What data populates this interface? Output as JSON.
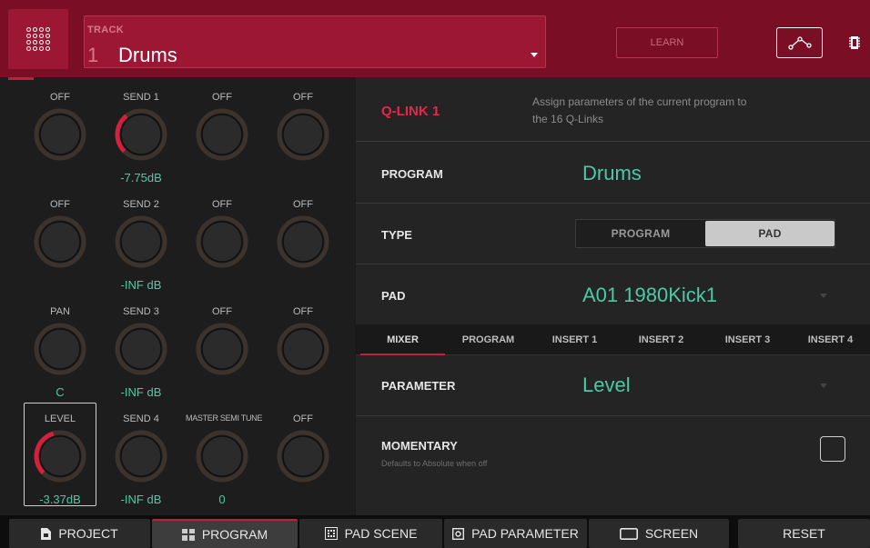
{
  "header": {
    "track_label": "TRACK",
    "track_number": "1",
    "track_name": "Drums",
    "learn_label": "LEARN",
    "grid_icon": "grid-dots-icon",
    "env_icon": "envelope-curve-icon",
    "chip_icon": "chip-icon"
  },
  "knobs": [
    {
      "label": "OFF",
      "value": "",
      "level": 0
    },
    {
      "label": "SEND 1",
      "value": "-7.75dB",
      "level": 0.36
    },
    {
      "label": "OFF",
      "value": "",
      "level": 0
    },
    {
      "label": "OFF",
      "value": "",
      "level": 0
    },
    {
      "label": "OFF",
      "value": "",
      "level": 0
    },
    {
      "label": "SEND 2",
      "value": "-INF dB",
      "level": 0
    },
    {
      "label": "OFF",
      "value": "",
      "level": 0
    },
    {
      "label": "OFF",
      "value": "",
      "level": 0
    },
    {
      "label": "PAN",
      "value": "C",
      "level": 0
    },
    {
      "label": "SEND 3",
      "value": "-INF dB",
      "level": 0
    },
    {
      "label": "OFF",
      "value": "",
      "level": 0
    },
    {
      "label": "OFF",
      "value": "",
      "level": 0
    },
    {
      "label": "LEVEL",
      "value": "-3.37dB",
      "level": 0.44,
      "selected": true
    },
    {
      "label": "SEND 4",
      "value": "-INF dB",
      "level": 0
    },
    {
      "label": "MASTER SEMI TUNE",
      "value": "0",
      "level": 0
    },
    {
      "label": "OFF",
      "value": "",
      "level": 0
    }
  ],
  "qlink": {
    "title": "Q-LINK 1",
    "description": "Assign parameters of the current program to the 16 Q-Links"
  },
  "program": {
    "label": "PROGRAM",
    "value": "Drums"
  },
  "type": {
    "label": "TYPE",
    "options": [
      "PROGRAM",
      "PAD"
    ],
    "selected": "PAD"
  },
  "pad": {
    "label": "PAD",
    "value": "A01 1980Kick1"
  },
  "tabs": [
    "MIXER",
    "PROGRAM",
    "INSERT 1",
    "INSERT 2",
    "INSERT 3",
    "INSERT 4"
  ],
  "active_tab": "MIXER",
  "parameter": {
    "label": "PARAMETER",
    "value": "Level"
  },
  "momentary": {
    "label": "MOMENTARY",
    "sub": "Defaults to Absolute when off",
    "checked": false
  },
  "bottom": [
    {
      "label": "PROJECT",
      "icon": "project-file-icon"
    },
    {
      "label": "PROGRAM",
      "icon": "program-grid-icon",
      "active": true
    },
    {
      "label": "PAD SCENE",
      "icon": "pad-scene-icon"
    },
    {
      "label": "PAD PARAMETER",
      "icon": "pad-parameter-icon"
    },
    {
      "label": "SCREEN",
      "icon": "screen-icon"
    },
    {
      "label": "RESET",
      "icon": ""
    }
  ],
  "colors": {
    "accent": "#c0203f",
    "value": "#4fc9a4",
    "header": "#7a0e24"
  }
}
